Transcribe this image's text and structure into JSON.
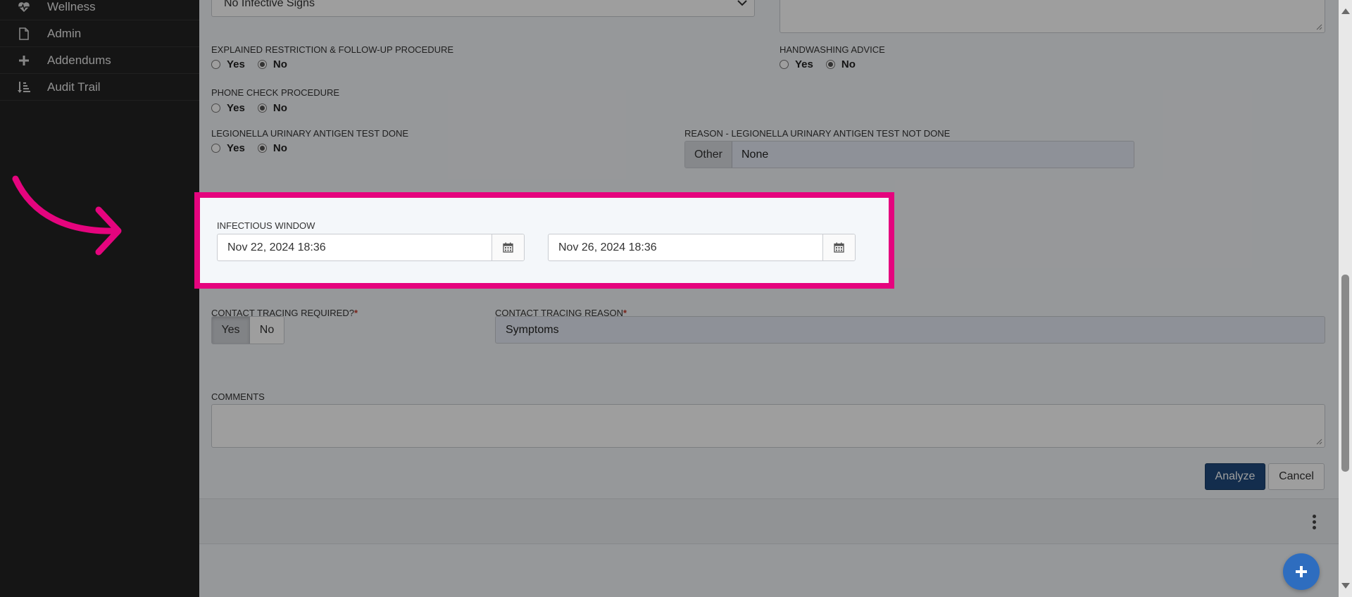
{
  "sidebar": {
    "items": [
      {
        "label": "Wellness",
        "icon": "heartbeat-icon"
      },
      {
        "label": "Admin",
        "icon": "file-icon"
      },
      {
        "label": "Addendums",
        "icon": "plus-icon"
      },
      {
        "label": "Audit Trail",
        "icon": "sort-list-icon"
      }
    ]
  },
  "form": {
    "infective_signs": {
      "value": "No Infective Signs"
    },
    "explained_restriction": {
      "label": "EXPLAINED RESTRICTION & FOLLOW-UP PROCEDURE",
      "yes": "Yes",
      "no": "No",
      "selected": "No"
    },
    "handwashing": {
      "label": "HANDWASHING ADVICE",
      "yes": "Yes",
      "no": "No",
      "selected": "No"
    },
    "phone_check": {
      "label": "PHONE CHECK PROCEDURE",
      "yes": "Yes",
      "no": "No",
      "selected": "No"
    },
    "legionella": {
      "label": "LEGIONELLA URINARY ANTIGEN TEST DONE",
      "yes": "Yes",
      "no": "No",
      "selected": "No"
    },
    "legionella_reason": {
      "label": "REASON - LEGIONELLA URINARY ANTIGEN TEST NOT DONE",
      "addon": "Other",
      "value": "None"
    },
    "infectious_window": {
      "label": "INFECTIOUS WINDOW",
      "start": "Nov 22, 2024 18:36",
      "end": "Nov 26, 2024 18:36"
    },
    "contact_tracing": {
      "label": "CONTACT TRACING REQUIRED?",
      "required_mark": "*",
      "yes": "Yes",
      "no": "No",
      "selected": "Yes"
    },
    "contact_reason": {
      "label": "CONTACT TRACING REASON",
      "required_mark": "*",
      "value": "Symptoms"
    },
    "comments": {
      "label": "COMMENTS",
      "value": ""
    },
    "buttons": {
      "analyze": "Analyze",
      "cancel": "Cancel"
    }
  },
  "colors": {
    "highlight": "#e5047e",
    "primary": "#1f4a7c",
    "fab": "#2e6dbf",
    "sidebar_bg": "#222222"
  }
}
